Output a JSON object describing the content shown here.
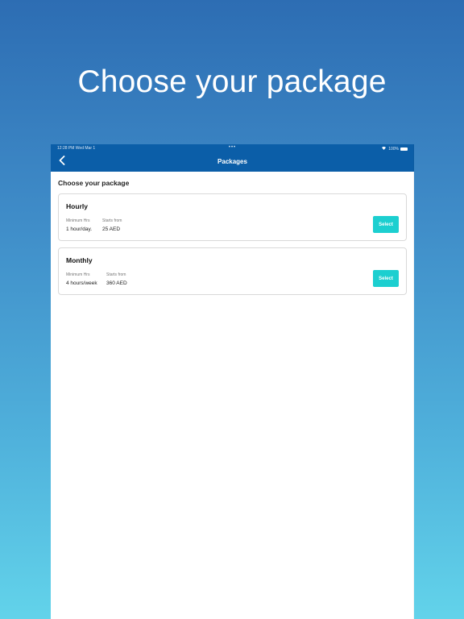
{
  "hero": {
    "title": "Choose your package"
  },
  "status_bar": {
    "time_date": "12:28 PM   Wed Mar 1",
    "center": "•••",
    "battery": "100%"
  },
  "nav": {
    "title": "Packages",
    "back_icon": "chevron-left-icon"
  },
  "section_title": "Choose your package",
  "packages": [
    {
      "name": "Hourly",
      "min_label": "Minimum Hrs",
      "min_value": "1 hour/day.",
      "price_label": "Starts from",
      "price_value": "25 AED",
      "button": "Select"
    },
    {
      "name": "Monthly",
      "min_label": "Minimum Hrs",
      "min_value": "4 hours/week",
      "price_label": "Starts from",
      "price_value": "360 AED",
      "button": "Select"
    }
  ],
  "colors": {
    "nav_bg": "#0b5ea8",
    "accent": "#1ccfd0"
  }
}
